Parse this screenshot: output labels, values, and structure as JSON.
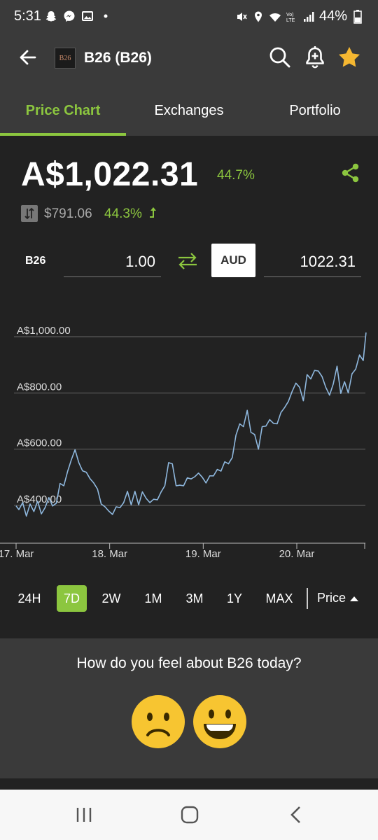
{
  "status_bar": {
    "time": "5:31",
    "battery": "44%",
    "left_icons": [
      "snapchat-icon",
      "messenger-icon",
      "gallery-icon",
      "dot-icon"
    ],
    "right_icons": [
      "mute-icon",
      "location-icon",
      "wifi-icon",
      "volte-icon",
      "signal-icon",
      "battery-icon"
    ]
  },
  "app_bar": {
    "coin_logo_text": "B26",
    "title": "B26 (B26)",
    "icons": [
      "back-arrow-icon",
      "search-icon",
      "add-alert-icon",
      "star-icon"
    ]
  },
  "tabs": [
    {
      "label": "Price Chart",
      "active": true
    },
    {
      "label": "Exchanges",
      "active": false
    },
    {
      "label": "Portfolio",
      "active": false
    }
  ],
  "price": {
    "value": "A$1,022.31",
    "change": "44.7%",
    "usd_value": "$791.06",
    "usd_change": "44.3%"
  },
  "converter": {
    "symbol": "B26",
    "amount": "1.00",
    "currency": "AUD",
    "result": "1022.31"
  },
  "chart_data": {
    "type": "line",
    "y_ticks": [
      "A$1,000.00",
      "A$800.00",
      "A$600.00",
      "A$400.00"
    ],
    "y_tick_values": [
      1000,
      800,
      600,
      400
    ],
    "x_ticks": [
      "17. Mar",
      "18. Mar",
      "19. Mar",
      "20. Mar"
    ],
    "x_tick_values": [
      0,
      1,
      2,
      3
    ],
    "ylim": [
      340,
      1040
    ],
    "xlim": [
      0,
      3.75
    ],
    "line_color": "#8fb8de",
    "series": [
      {
        "values": [
          [
            0.0,
            398
          ],
          [
            0.03,
            385
          ],
          [
            0.07,
            410
          ],
          [
            0.11,
            362
          ],
          [
            0.15,
            405
          ],
          [
            0.19,
            378
          ],
          [
            0.23,
            415
          ],
          [
            0.27,
            370
          ],
          [
            0.31,
            392
          ],
          [
            0.35,
            428
          ],
          [
            0.39,
            398
          ],
          [
            0.43,
            408
          ],
          [
            0.47,
            478
          ],
          [
            0.51,
            470
          ],
          [
            0.55,
            520
          ],
          [
            0.59,
            562
          ],
          [
            0.63,
            598
          ],
          [
            0.67,
            552
          ],
          [
            0.71,
            523
          ],
          [
            0.75,
            518
          ],
          [
            0.79,
            495
          ],
          [
            0.83,
            480
          ],
          [
            0.87,
            458
          ],
          [
            0.91,
            405
          ],
          [
            0.95,
            395
          ],
          [
            0.99,
            380
          ],
          [
            1.03,
            368
          ],
          [
            1.07,
            395
          ],
          [
            1.11,
            392
          ],
          [
            1.15,
            410
          ],
          [
            1.19,
            450
          ],
          [
            1.23,
            402
          ],
          [
            1.27,
            450
          ],
          [
            1.31,
            402
          ],
          [
            1.35,
            448
          ],
          [
            1.39,
            425
          ],
          [
            1.43,
            410
          ],
          [
            1.47,
            422
          ],
          [
            1.51,
            420
          ],
          [
            1.55,
            448
          ],
          [
            1.59,
            470
          ],
          [
            1.63,
            552
          ],
          [
            1.67,
            548
          ],
          [
            1.71,
            470
          ],
          [
            1.75,
            472
          ],
          [
            1.79,
            470
          ],
          [
            1.83,
            498
          ],
          [
            1.87,
            494
          ],
          [
            1.91,
            502
          ],
          [
            1.95,
            515
          ],
          [
            1.99,
            500
          ],
          [
            2.03,
            480
          ],
          [
            2.07,
            505
          ],
          [
            2.11,
            505
          ],
          [
            2.15,
            528
          ],
          [
            2.19,
            522
          ],
          [
            2.23,
            555
          ],
          [
            2.27,
            548
          ],
          [
            2.31,
            570
          ],
          [
            2.35,
            650
          ],
          [
            2.39,
            690
          ],
          [
            2.43,
            680
          ],
          [
            2.47,
            738
          ],
          [
            2.51,
            660
          ],
          [
            2.55,
            652
          ],
          [
            2.59,
            600
          ],
          [
            2.63,
            680
          ],
          [
            2.67,
            682
          ],
          [
            2.71,
            705
          ],
          [
            2.75,
            692
          ],
          [
            2.79,
            690
          ],
          [
            2.83,
            730
          ],
          [
            2.87,
            748
          ],
          [
            2.91,
            770
          ],
          [
            2.95,
            805
          ],
          [
            2.99,
            835
          ],
          [
            3.03,
            820
          ],
          [
            3.07,
            772
          ],
          [
            3.11,
            865
          ],
          [
            3.15,
            850
          ],
          [
            3.19,
            880
          ],
          [
            3.23,
            878
          ],
          [
            3.27,
            858
          ],
          [
            3.31,
            820
          ],
          [
            3.35,
            792
          ],
          [
            3.39,
            832
          ],
          [
            3.43,
            895
          ],
          [
            3.47,
            798
          ],
          [
            3.51,
            840
          ],
          [
            3.55,
            800
          ],
          [
            3.59,
            868
          ],
          [
            3.63,
            885
          ],
          [
            3.67,
            935
          ],
          [
            3.71,
            915
          ],
          [
            3.74,
            1015
          ]
        ]
      }
    ]
  },
  "ranges": [
    {
      "label": "24H",
      "active": false
    },
    {
      "label": "7D",
      "active": true
    },
    {
      "label": "2W",
      "active": false
    },
    {
      "label": "1M",
      "active": false
    },
    {
      "label": "3M",
      "active": false
    },
    {
      "label": "1Y",
      "active": false
    },
    {
      "label": "MAX",
      "active": false
    }
  ],
  "sort_label": "Price",
  "feedback": {
    "question": "How do you feel about B26 today?",
    "options": [
      "sad-face-icon",
      "happy-face-icon"
    ]
  },
  "nav_bar": {
    "icons": [
      "recent-apps-icon",
      "home-icon",
      "back-icon"
    ]
  },
  "colors": {
    "accent": "#8cc63f",
    "background": "#222222",
    "bar": "#3a3a3a",
    "star": "#f5b731",
    "emoji": "#f7c531"
  }
}
